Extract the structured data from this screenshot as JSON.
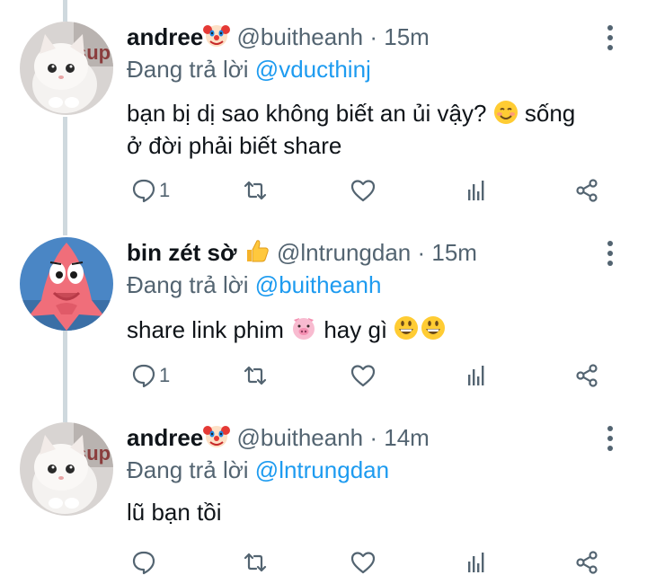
{
  "tweets": [
    {
      "name": "andree",
      "name_emoji": "clown-face-emoji",
      "handle": "@buitheanh",
      "time": "· 15m",
      "replying_label": "Đang trả lời",
      "replying_to": "@vducthinj",
      "text_line1": "bạn bị dị sao không biết an ủi vậy?",
      "text_emoji": "smiling-face-emoji",
      "text_line1_tail": "sống",
      "text_line2": "ở đời phải biết share",
      "reply_count": "1",
      "avatar": "white-kitten-avatar"
    },
    {
      "name": "bin zét sờ",
      "name_emoji": "thumbs-up-emoji",
      "handle": "@lntrungdan",
      "time": "· 15m",
      "replying_label": "Đang trả lời",
      "replying_to": "@buitheanh",
      "text_part1": "share link phim",
      "text_emoji1": "pig-face-emoji",
      "text_part2": "hay gì",
      "text_emoji2": "grinning-face-emoji",
      "reply_count": "1",
      "avatar": "pink-starfish-avatar"
    },
    {
      "name": "andree",
      "name_emoji": "clown-face-emoji",
      "handle": "@buitheanh",
      "time": "· 14m",
      "replying_label": "Đang trả lời",
      "replying_to": "@lntrungdan",
      "text": "lũ bạn tồi",
      "reply_count": "",
      "avatar": "white-kitten-avatar"
    }
  ],
  "colors": {
    "link": "#1d9bf0",
    "secondary_text": "#536471",
    "thread_line": "#cfd9de"
  }
}
